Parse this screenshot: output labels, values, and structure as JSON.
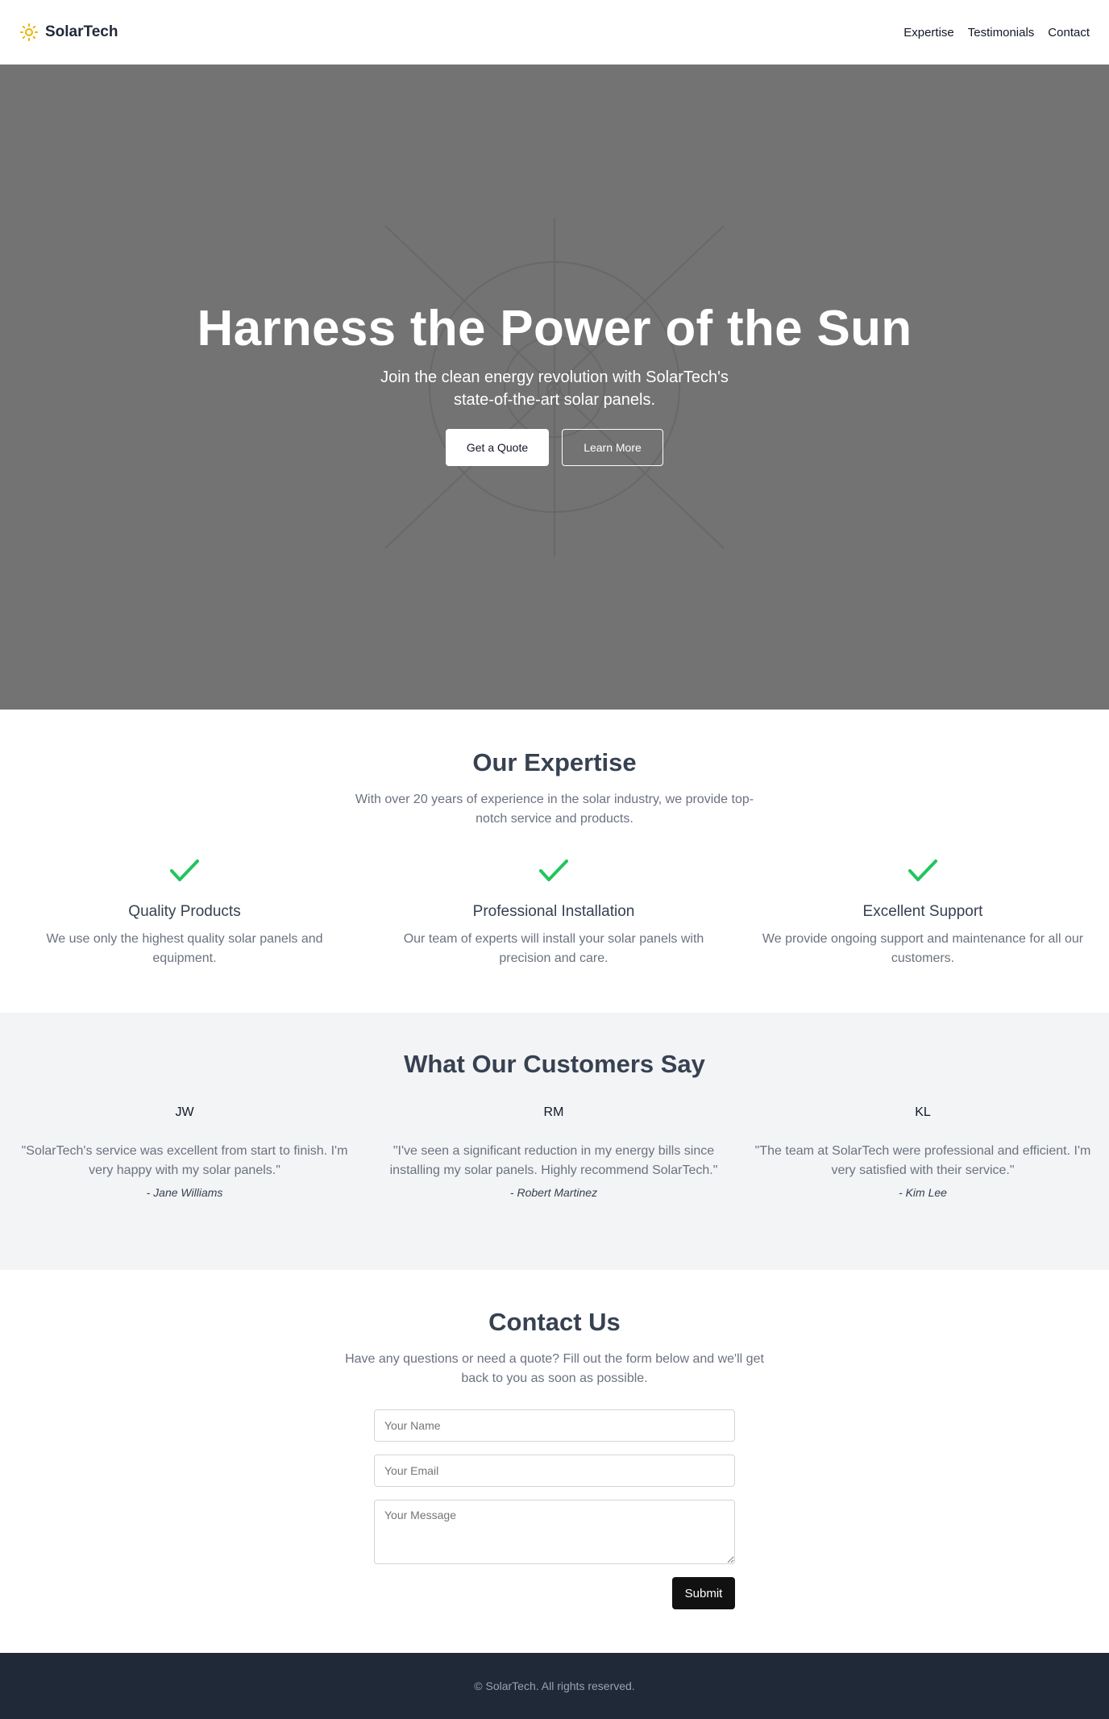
{
  "header": {
    "brand": "SolarTech",
    "nav": [
      "Expertise",
      "Testimonials",
      "Contact"
    ]
  },
  "hero": {
    "title": "Harness the Power of the Sun",
    "subtitle": "Join the clean energy revolution with SolarTech's state-of-the-art solar panels.",
    "primary_button": "Get a Quote",
    "secondary_button": "Learn More"
  },
  "expertise": {
    "title": "Our Expertise",
    "description": "With over 20 years of experience in the solar industry, we provide top-notch service and products.",
    "features": [
      {
        "icon": "check-icon",
        "title": "Quality Products",
        "text": "We use only the highest quality solar panels and equipment."
      },
      {
        "icon": "check-icon",
        "title": "Professional Installation",
        "text": "Our team of experts will install your solar panels with precision and care."
      },
      {
        "icon": "check-icon",
        "title": "Excellent Support",
        "text": "We provide ongoing support and maintenance for all our customers."
      }
    ]
  },
  "testimonials": {
    "title": "What Our Customers Say",
    "items": [
      {
        "initials": "JW",
        "quote": "\"SolarTech's service was excellent from start to finish. I'm very happy with my solar panels.\"",
        "author": "- Jane Williams"
      },
      {
        "initials": "RM",
        "quote": "\"I've seen a significant reduction in my energy bills since installing my solar panels. Highly recommend SolarTech.\"",
        "author": "- Robert Martinez"
      },
      {
        "initials": "KL",
        "quote": "\"The team at SolarTech were professional and efficient. I'm very satisfied with their service.\"",
        "author": "- Kim Lee"
      }
    ]
  },
  "contact": {
    "title": "Contact Us",
    "description": "Have any questions or need a quote? Fill out the form below and we'll get back to you as soon as possible.",
    "name_placeholder": "Your Name",
    "email_placeholder": "Your Email",
    "message_placeholder": "Your Message",
    "submit": "Submit"
  },
  "footer": {
    "text": "© SolarTech. All rights reserved."
  },
  "colors": {
    "accent_check": "#22c55e",
    "sun_icon": "#eab308",
    "hero_bg": "#737373",
    "footer_bg": "#1f2937"
  }
}
